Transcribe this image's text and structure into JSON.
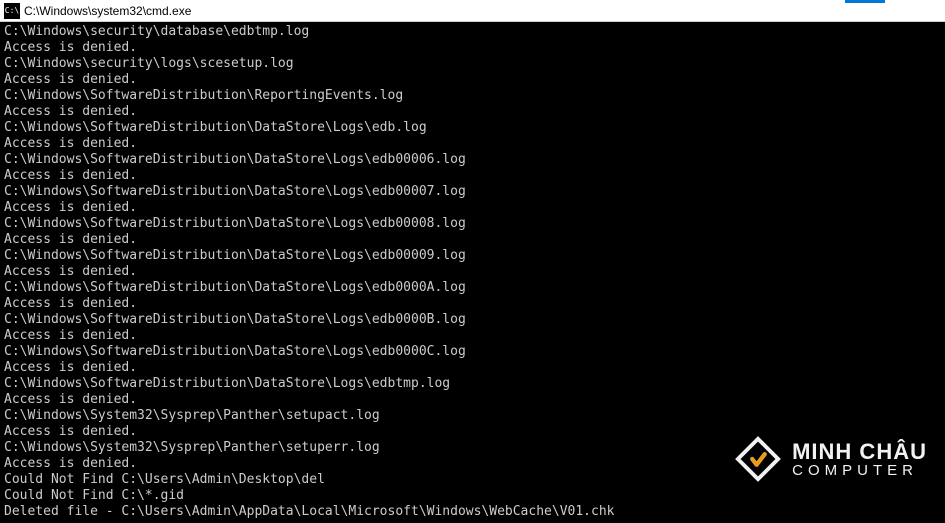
{
  "titlebar": {
    "icon_label": "C:\\",
    "title": "C:\\Windows\\system32\\cmd.exe"
  },
  "terminal": {
    "lines": [
      "C:\\Windows\\security\\database\\edbtmp.log",
      "Access is denied.",
      "C:\\Windows\\security\\logs\\scesetup.log",
      "Access is denied.",
      "C:\\Windows\\SoftwareDistribution\\ReportingEvents.log",
      "Access is denied.",
      "C:\\Windows\\SoftwareDistribution\\DataStore\\Logs\\edb.log",
      "Access is denied.",
      "C:\\Windows\\SoftwareDistribution\\DataStore\\Logs\\edb00006.log",
      "Access is denied.",
      "C:\\Windows\\SoftwareDistribution\\DataStore\\Logs\\edb00007.log",
      "Access is denied.",
      "C:\\Windows\\SoftwareDistribution\\DataStore\\Logs\\edb00008.log",
      "Access is denied.",
      "C:\\Windows\\SoftwareDistribution\\DataStore\\Logs\\edb00009.log",
      "Access is denied.",
      "C:\\Windows\\SoftwareDistribution\\DataStore\\Logs\\edb0000A.log",
      "Access is denied.",
      "C:\\Windows\\SoftwareDistribution\\DataStore\\Logs\\edb0000B.log",
      "Access is denied.",
      "C:\\Windows\\SoftwareDistribution\\DataStore\\Logs\\edb0000C.log",
      "Access is denied.",
      "C:\\Windows\\SoftwareDistribution\\DataStore\\Logs\\edbtmp.log",
      "Access is denied.",
      "C:\\Windows\\System32\\Sysprep\\Panther\\setupact.log",
      "Access is denied.",
      "C:\\Windows\\System32\\Sysprep\\Panther\\setuperr.log",
      "Access is denied.",
      "Could Not Find C:\\Users\\Admin\\Desktop\\del",
      "Could Not Find C:\\*.gid",
      "Deleted file - C:\\Users\\Admin\\AppData\\Local\\Microsoft\\Windows\\WebCache\\V01.chk"
    ]
  },
  "watermark": {
    "line1": "MINH CHÂU",
    "line2": "COMPUTER"
  }
}
